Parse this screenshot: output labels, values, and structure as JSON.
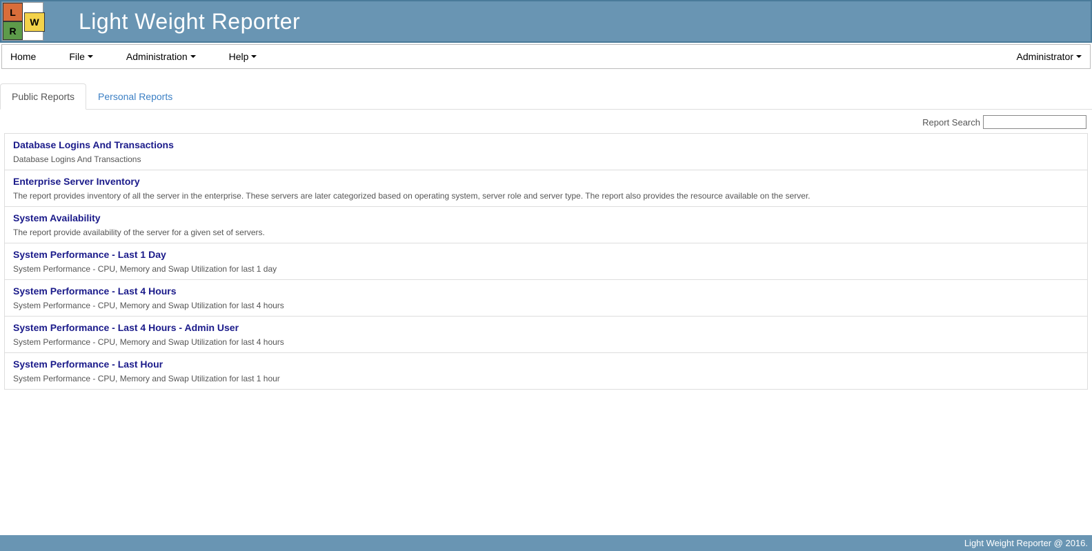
{
  "header": {
    "title": "Light Weight Reporter"
  },
  "menu": {
    "home": "Home",
    "file": "File",
    "admin": "Administration",
    "help": "Help",
    "user": "Administrator"
  },
  "tabs": {
    "public": "Public Reports",
    "personal": "Personal Reports"
  },
  "search": {
    "label": "Report Search"
  },
  "reports": [
    {
      "title": "Database Logins And Transactions",
      "desc": "Database Logins And Transactions"
    },
    {
      "title": "Enterprise Server Inventory",
      "desc": "The report provides inventory of all the server in the enterprise. These servers are later categorized based on operating system, server role and server type. The report also provides the resource available on the server."
    },
    {
      "title": "System Availability",
      "desc": "The report provide availability of the server for a given set of servers."
    },
    {
      "title": "System Performance - Last 1 Day",
      "desc": "System Performance - CPU, Memory and Swap Utilization for last 1 day"
    },
    {
      "title": "System Performance - Last 4 Hours",
      "desc": "System Performance - CPU, Memory and Swap Utilization for last 4 hours"
    },
    {
      "title": "System Performance - Last 4 Hours - Admin User",
      "desc": "System Performance - CPU, Memory and Swap Utilization for last 4 hours"
    },
    {
      "title": "System Performance - Last Hour",
      "desc": "System Performance - CPU, Memory and Swap Utilization for last 1 hour"
    }
  ],
  "footer": {
    "text": "Light Weight Reporter @ 2016."
  }
}
